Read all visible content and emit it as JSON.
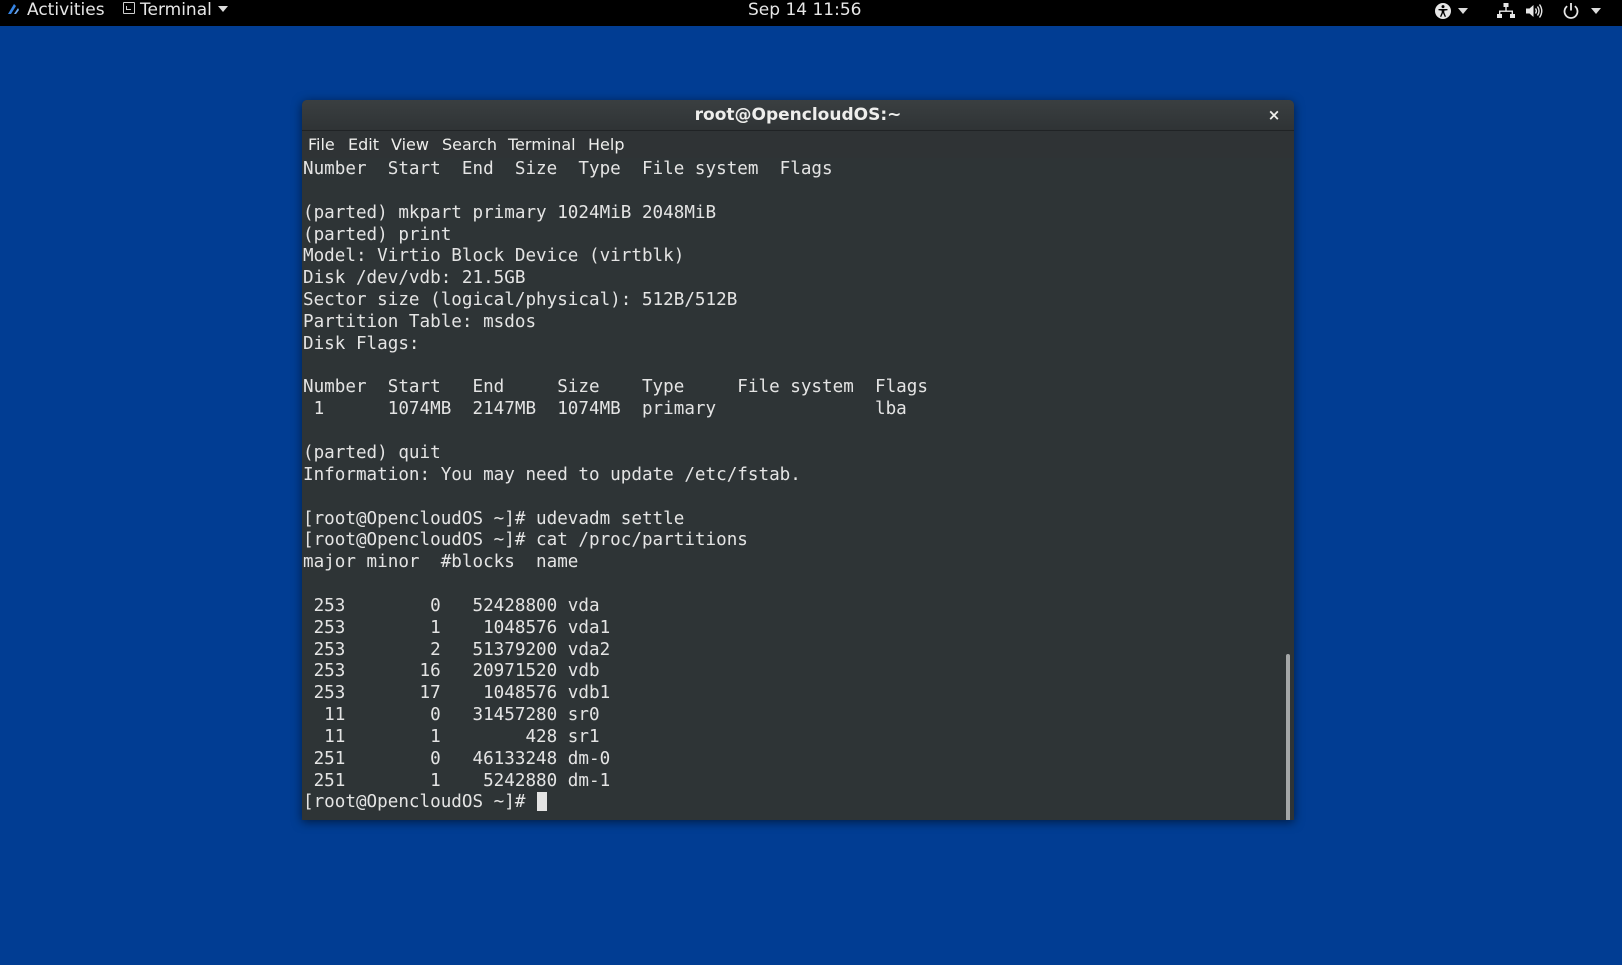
{
  "topbar": {
    "activities_label": "Activities",
    "app_menu_label": "Terminal",
    "clock": "Sep 14  11:56",
    "icons": [
      "accessibility-icon",
      "network-icon",
      "volume-icon",
      "power-icon"
    ]
  },
  "window": {
    "title": "root@OpencloudOS:~",
    "close_label": "×",
    "menu": [
      "File",
      "Edit",
      "View",
      "Search",
      "Terminal",
      "Help"
    ]
  },
  "terminal": {
    "lines": [
      "Number  Start  End  Size  Type  File system  Flags",
      "",
      "(parted) mkpart primary 1024MiB 2048MiB",
      "(parted) print",
      "Model: Virtio Block Device (virtblk)",
      "Disk /dev/vdb: 21.5GB",
      "Sector size (logical/physical): 512B/512B",
      "Partition Table: msdos",
      "Disk Flags:",
      "",
      "Number  Start   End     Size    Type     File system  Flags",
      " 1      1074MB  2147MB  1074MB  primary               lba",
      "",
      "(parted) quit",
      "Information: You may need to update /etc/fstab.",
      "",
      "[root@OpencloudOS ~]# udevadm settle",
      "[root@OpencloudOS ~]# cat /proc/partitions",
      "major minor  #blocks  name",
      "",
      " 253        0   52428800 vda",
      " 253        1    1048576 vda1",
      " 253        2   51379200 vda2",
      " 253       16   20971520 vdb",
      " 253       17    1048576 vdb1",
      "  11        0   31457280 sr0",
      "  11        1        428 sr1",
      " 251        0   46133248 dm-0",
      " 251        1    5242880 dm-1"
    ],
    "prompt": "[root@OpencloudOS ~]# "
  },
  "colors": {
    "desktop": "#013d93",
    "topbar": "#000000",
    "terminal_bg": "#2e3436",
    "terminal_fg": "#e4e4e4",
    "activities_logo": "#3584e4"
  }
}
